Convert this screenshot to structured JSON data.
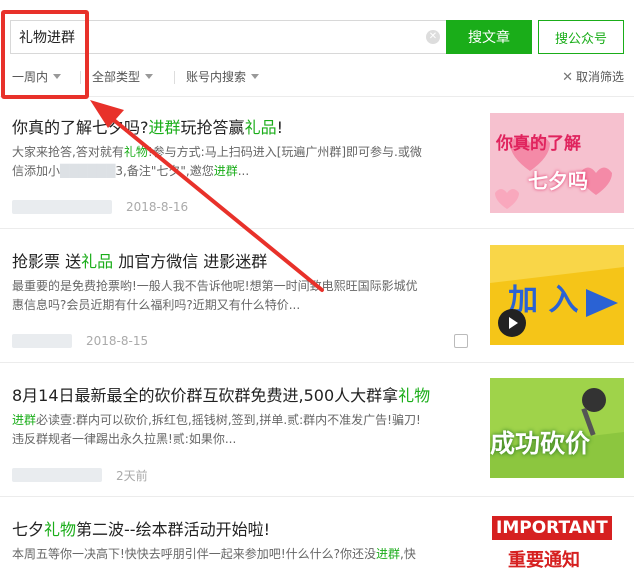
{
  "search": {
    "query": "礼物进群",
    "btn_article": "搜文章",
    "btn_account": "搜公众号"
  },
  "filters": {
    "time": "一周内",
    "type": "全部类型",
    "account": "账号内搜索",
    "cancel": "取消筛选"
  },
  "results": [
    {
      "title_parts": [
        "你真的了解",
        "七夕",
        "吗?",
        "进群",
        "玩抢答赢",
        "礼品",
        "!"
      ],
      "snippet_line1": [
        "大家来抢答,答对就有",
        "礼物",
        "!参与方式:马上扫码进入[玩遍广州群]即可参与.或微"
      ],
      "snippet_line2": [
        "信添加小",
        "██████",
        "3,备注\"七夕\",邀您",
        "进群",
        "..."
      ],
      "date": "2018-8-16",
      "thumb": {
        "line1": "你真的了解",
        "line2": "七夕吗"
      }
    },
    {
      "title_parts": [
        "抢影票 送",
        "礼品",
        " 加官方微信 进影迷群"
      ],
      "snippet_line1": [
        "最重要的是免费抢票哟!一般人我不告诉他呢!想第一时间致电熙旺国际影城优"
      ],
      "snippet_line2": [
        "惠信息吗?会员近期有什么福利吗?近期又有什么特价..."
      ],
      "date": "2018-8-15",
      "thumb": {
        "line1": "加 入"
      }
    },
    {
      "title_parts": [
        "8月14日最新最全的砍价群互砍群免费进,500人大群拿",
        "礼物"
      ],
      "snippet_line1": [
        "进群",
        "必读壹:群内可以砍价,拆红包,摇钱树,签到,拼单.贰:群内不准发广告!骗刀!"
      ],
      "snippet_line2": [
        "违反群规者一律踢出永久拉黑!贰:如果你..."
      ],
      "date": "2天前",
      "thumb": {
        "line1": "成功砍价"
      }
    },
    {
      "title_parts": [
        "七夕",
        "礼物",
        "第二波--绘本群活动开始啦!"
      ],
      "snippet_line1": [
        "本周五等你一决高下!快快去呼朋引伴一起来参加吧!什么什么?你还没",
        "进群",
        ",快"
      ],
      "thumb": {
        "line1": "IMPORTANT",
        "line2": "重要通知"
      }
    }
  ],
  "colors": {
    "accent": "#1aad19",
    "highlight": "#e8312a"
  }
}
